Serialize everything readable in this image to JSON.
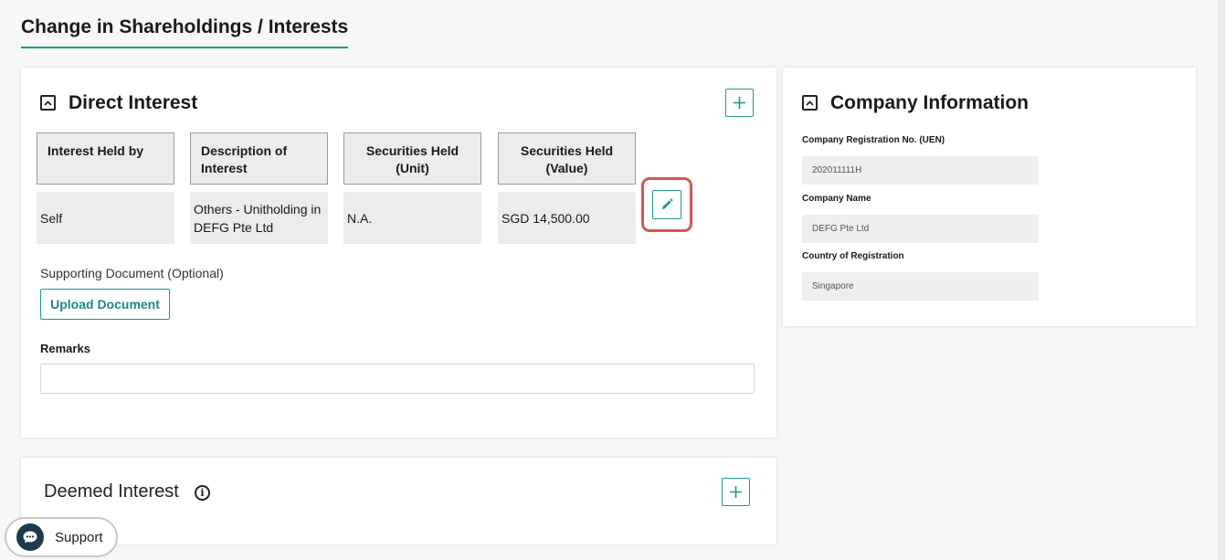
{
  "page": {
    "title": "Change in Shareholdings / Interests"
  },
  "direct_interest": {
    "title": "Direct Interest",
    "table": {
      "headers": [
        "Interest Held by",
        "Description of Interest",
        "Securities Held (Unit)",
        "Securities Held (Value)"
      ],
      "rows": [
        [
          "Self",
          "Others - Unitholding in DEFG Pte Ltd",
          "N.A.",
          "SGD 14,500.00"
        ]
      ]
    },
    "supporting_document_label": "Supporting Document (Optional)",
    "upload_button_label": "Upload Document",
    "remarks_label": "Remarks",
    "remarks_value": "",
    "icons": {
      "collapse": "chevron-up-icon",
      "add": "plus-icon",
      "edit": "pencil-icon"
    }
  },
  "company_information": {
    "title": "Company Information",
    "fields": [
      {
        "label": "Company Registration No. (UEN)",
        "value": "202011111H"
      },
      {
        "label": "Company Name",
        "value": "DEFG Pte Ltd"
      },
      {
        "label": "Country of Registration",
        "value": "Singapore"
      }
    ]
  },
  "deemed_interest": {
    "title": "Deemed Interest",
    "info_icon": "i"
  },
  "support_widget": {
    "label": "Support"
  },
  "colors": {
    "accent": "#1a9a8e",
    "highlight": "#d9574a",
    "support_icon_bg": "#1e3a4c"
  }
}
